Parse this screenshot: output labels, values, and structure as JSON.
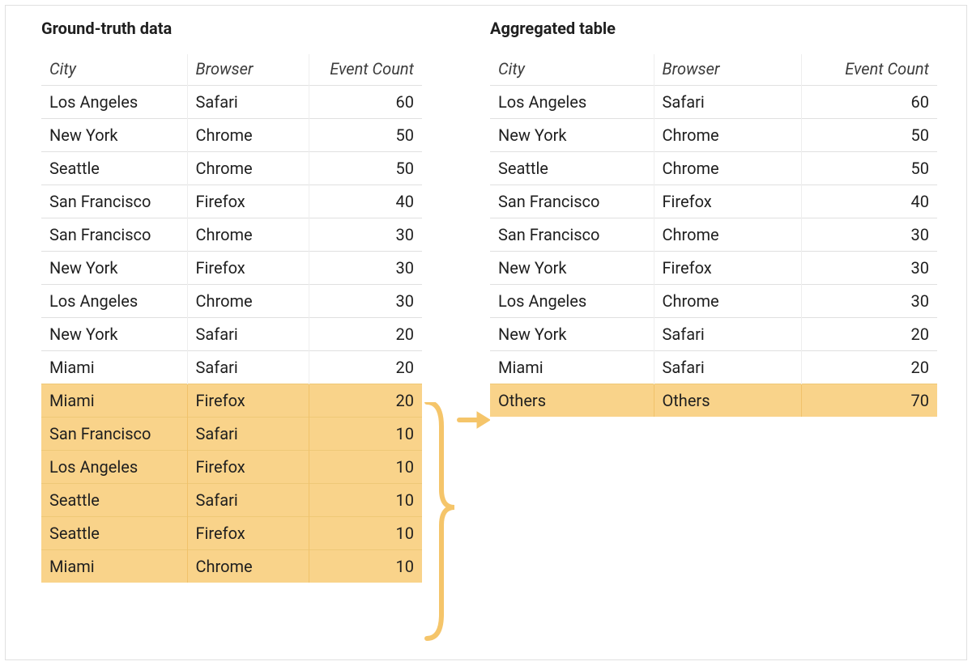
{
  "colors": {
    "highlight": "#f9d38a",
    "accent": "#f5c56a",
    "border": "#e0e0e0"
  },
  "left": {
    "title": "Ground-truth data",
    "columns": {
      "city": "City",
      "browser": "Browser",
      "event_count": "Event\nCount"
    },
    "rows": [
      {
        "city": "Los Angeles",
        "browser": "Safari",
        "count": 60,
        "highlight": false
      },
      {
        "city": "New York",
        "browser": "Chrome",
        "count": 50,
        "highlight": false
      },
      {
        "city": "Seattle",
        "browser": "Chrome",
        "count": 50,
        "highlight": false
      },
      {
        "city": "San Francisco",
        "browser": "Firefox",
        "count": 40,
        "highlight": false
      },
      {
        "city": "San Francisco",
        "browser": "Chrome",
        "count": 30,
        "highlight": false
      },
      {
        "city": "New York",
        "browser": "Firefox",
        "count": 30,
        "highlight": false
      },
      {
        "city": "Los Angeles",
        "browser": "Chrome",
        "count": 30,
        "highlight": false
      },
      {
        "city": "New York",
        "browser": "Safari",
        "count": 20,
        "highlight": false
      },
      {
        "city": "Miami",
        "browser": "Safari",
        "count": 20,
        "highlight": false
      },
      {
        "city": "Miami",
        "browser": "Firefox",
        "count": 20,
        "highlight": true
      },
      {
        "city": "San Francisco",
        "browser": "Safari",
        "count": 10,
        "highlight": true
      },
      {
        "city": "Los Angeles",
        "browser": "Firefox",
        "count": 10,
        "highlight": true
      },
      {
        "city": "Seattle",
        "browser": "Safari",
        "count": 10,
        "highlight": true
      },
      {
        "city": "Seattle",
        "browser": "Firefox",
        "count": 10,
        "highlight": true
      },
      {
        "city": "Miami",
        "browser": "Chrome",
        "count": 10,
        "highlight": true
      }
    ]
  },
  "right": {
    "title": "Aggregated table",
    "columns": {
      "city": "City",
      "browser": "Browser",
      "event_count": "Event\nCount"
    },
    "rows": [
      {
        "city": "Los Angeles",
        "browser": "Safari",
        "count": 60,
        "highlight": false
      },
      {
        "city": "New York",
        "browser": "Chrome",
        "count": 50,
        "highlight": false
      },
      {
        "city": "Seattle",
        "browser": "Chrome",
        "count": 50,
        "highlight": false
      },
      {
        "city": "San Francisco",
        "browser": "Firefox",
        "count": 40,
        "highlight": false
      },
      {
        "city": "San Francisco",
        "browser": "Chrome",
        "count": 30,
        "highlight": false
      },
      {
        "city": "New York",
        "browser": "Firefox",
        "count": 30,
        "highlight": false
      },
      {
        "city": "Los Angeles",
        "browser": "Chrome",
        "count": 30,
        "highlight": false
      },
      {
        "city": "New York",
        "browser": "Safari",
        "count": 20,
        "highlight": false
      },
      {
        "city": "Miami",
        "browser": "Safari",
        "count": 20,
        "highlight": false
      },
      {
        "city": "Others",
        "browser": "Others",
        "count": 70,
        "highlight": true
      }
    ]
  }
}
